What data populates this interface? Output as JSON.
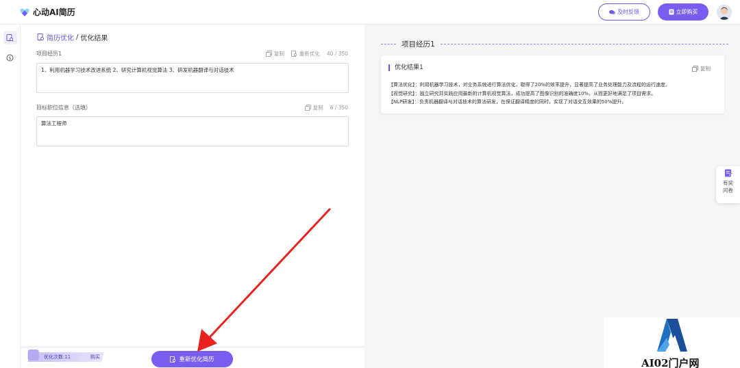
{
  "app": {
    "name": "心动AI简历"
  },
  "header": {
    "feedback_label": "及时反馈",
    "buy_label": "立即购买"
  },
  "breadcrumb": {
    "link": "简历优化",
    "separator": "/",
    "current": "优化结果"
  },
  "fields": {
    "project": {
      "label": "项目经历1",
      "copy_label": "复制",
      "reopt_label": "重新优化",
      "count": "40 / 350",
      "value": "1、利用机器学习技术改进系统 2、研究计算机视觉算法 3、研发机器翻译与对话技术"
    },
    "target": {
      "label": "目标职位信息（选填）",
      "copy_label": "复制",
      "count": "6 / 350",
      "value": "算法工程师"
    }
  },
  "bottom": {
    "quota": "优化次数:11",
    "buy": "购买",
    "reoptimize_button": "重新优化简历"
  },
  "result": {
    "section_title": "项目经历1",
    "card_title": "优化结果1",
    "copy_label": "复制",
    "lines": [
      "【算法优化】：利用机器学习技术，对业务系统进行算法优化，取得了20%的效率提升，显著提高了业务处理能力及流程的运行速度。",
      "【视觉研究】：独立研究并实践应用最新的计算机视觉算法，成功提高了图像识别的准确度10%，从而更好地满足了项目需求。",
      "【NLP研发】：负责机器翻译与对话技术的算法研发，在保证翻译精度的同时，实现了对话交互效果的50%提升。"
    ]
  },
  "survey": {
    "label": "有奖问卷"
  },
  "watermark": {
    "text": "AI02门户网"
  },
  "colors": {
    "accent": "#7a5cf0",
    "arrow": "#e8231f"
  }
}
